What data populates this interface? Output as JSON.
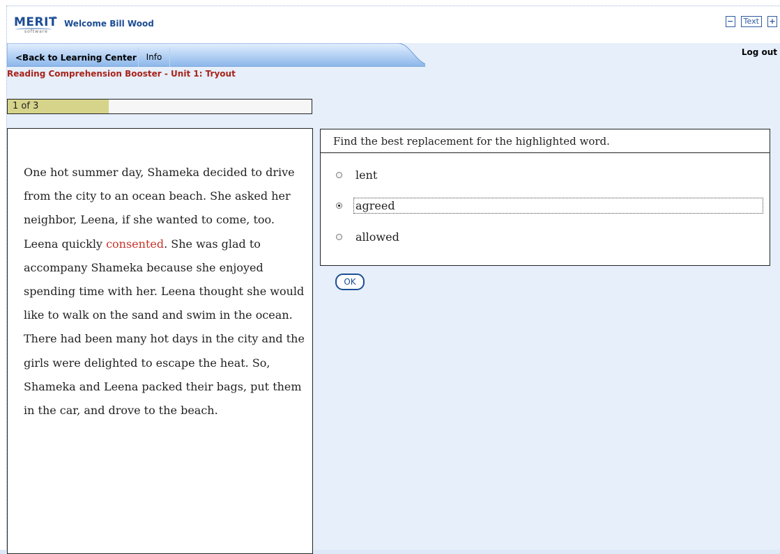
{
  "header": {
    "logo_text": "MERIT",
    "logo_subtext": "software",
    "welcome": "Welcome Bill Wood",
    "text_size": {
      "decrease": "−",
      "label": "Text",
      "increase": "+"
    }
  },
  "nav": {
    "back": "<Back to Learning Center",
    "info": "Info",
    "logout": "Log out"
  },
  "breadcrumb": "Reading Comprehension Booster - Unit 1: Tryout",
  "progress": {
    "label": "1 of 3",
    "fraction": 0.333
  },
  "passage": {
    "before": "One hot summer day, Shameka decided to drive from the city to an ocean beach. She asked her neighbor, Leena, if she wanted to come, too. Leena quickly ",
    "highlighted": "consented",
    "after": ". She was glad to accompany Shameka because she enjoyed spending time with her. Leena thought she would like to walk on the sand and swim in the ocean. There had been many hot days in the city and the girls were delighted to escape the heat. So, Shameka and Leena packed their bags, put them in the car, and drove to the beach."
  },
  "question": {
    "prompt": "Find the best replacement for the highlighted word.",
    "options": [
      {
        "label": "lent",
        "selected": false
      },
      {
        "label": "agreed",
        "selected": true
      },
      {
        "label": "allowed",
        "selected": false
      }
    ],
    "ok_label": "OK"
  },
  "colors": {
    "brand": "#1c4d94",
    "breadcrumb": "#a8231a",
    "highlight": "#c73227",
    "progress_fill": "#d6d48a",
    "nav_gradient_top": "#e3efff",
    "nav_gradient_bottom": "#8ab6ea"
  }
}
